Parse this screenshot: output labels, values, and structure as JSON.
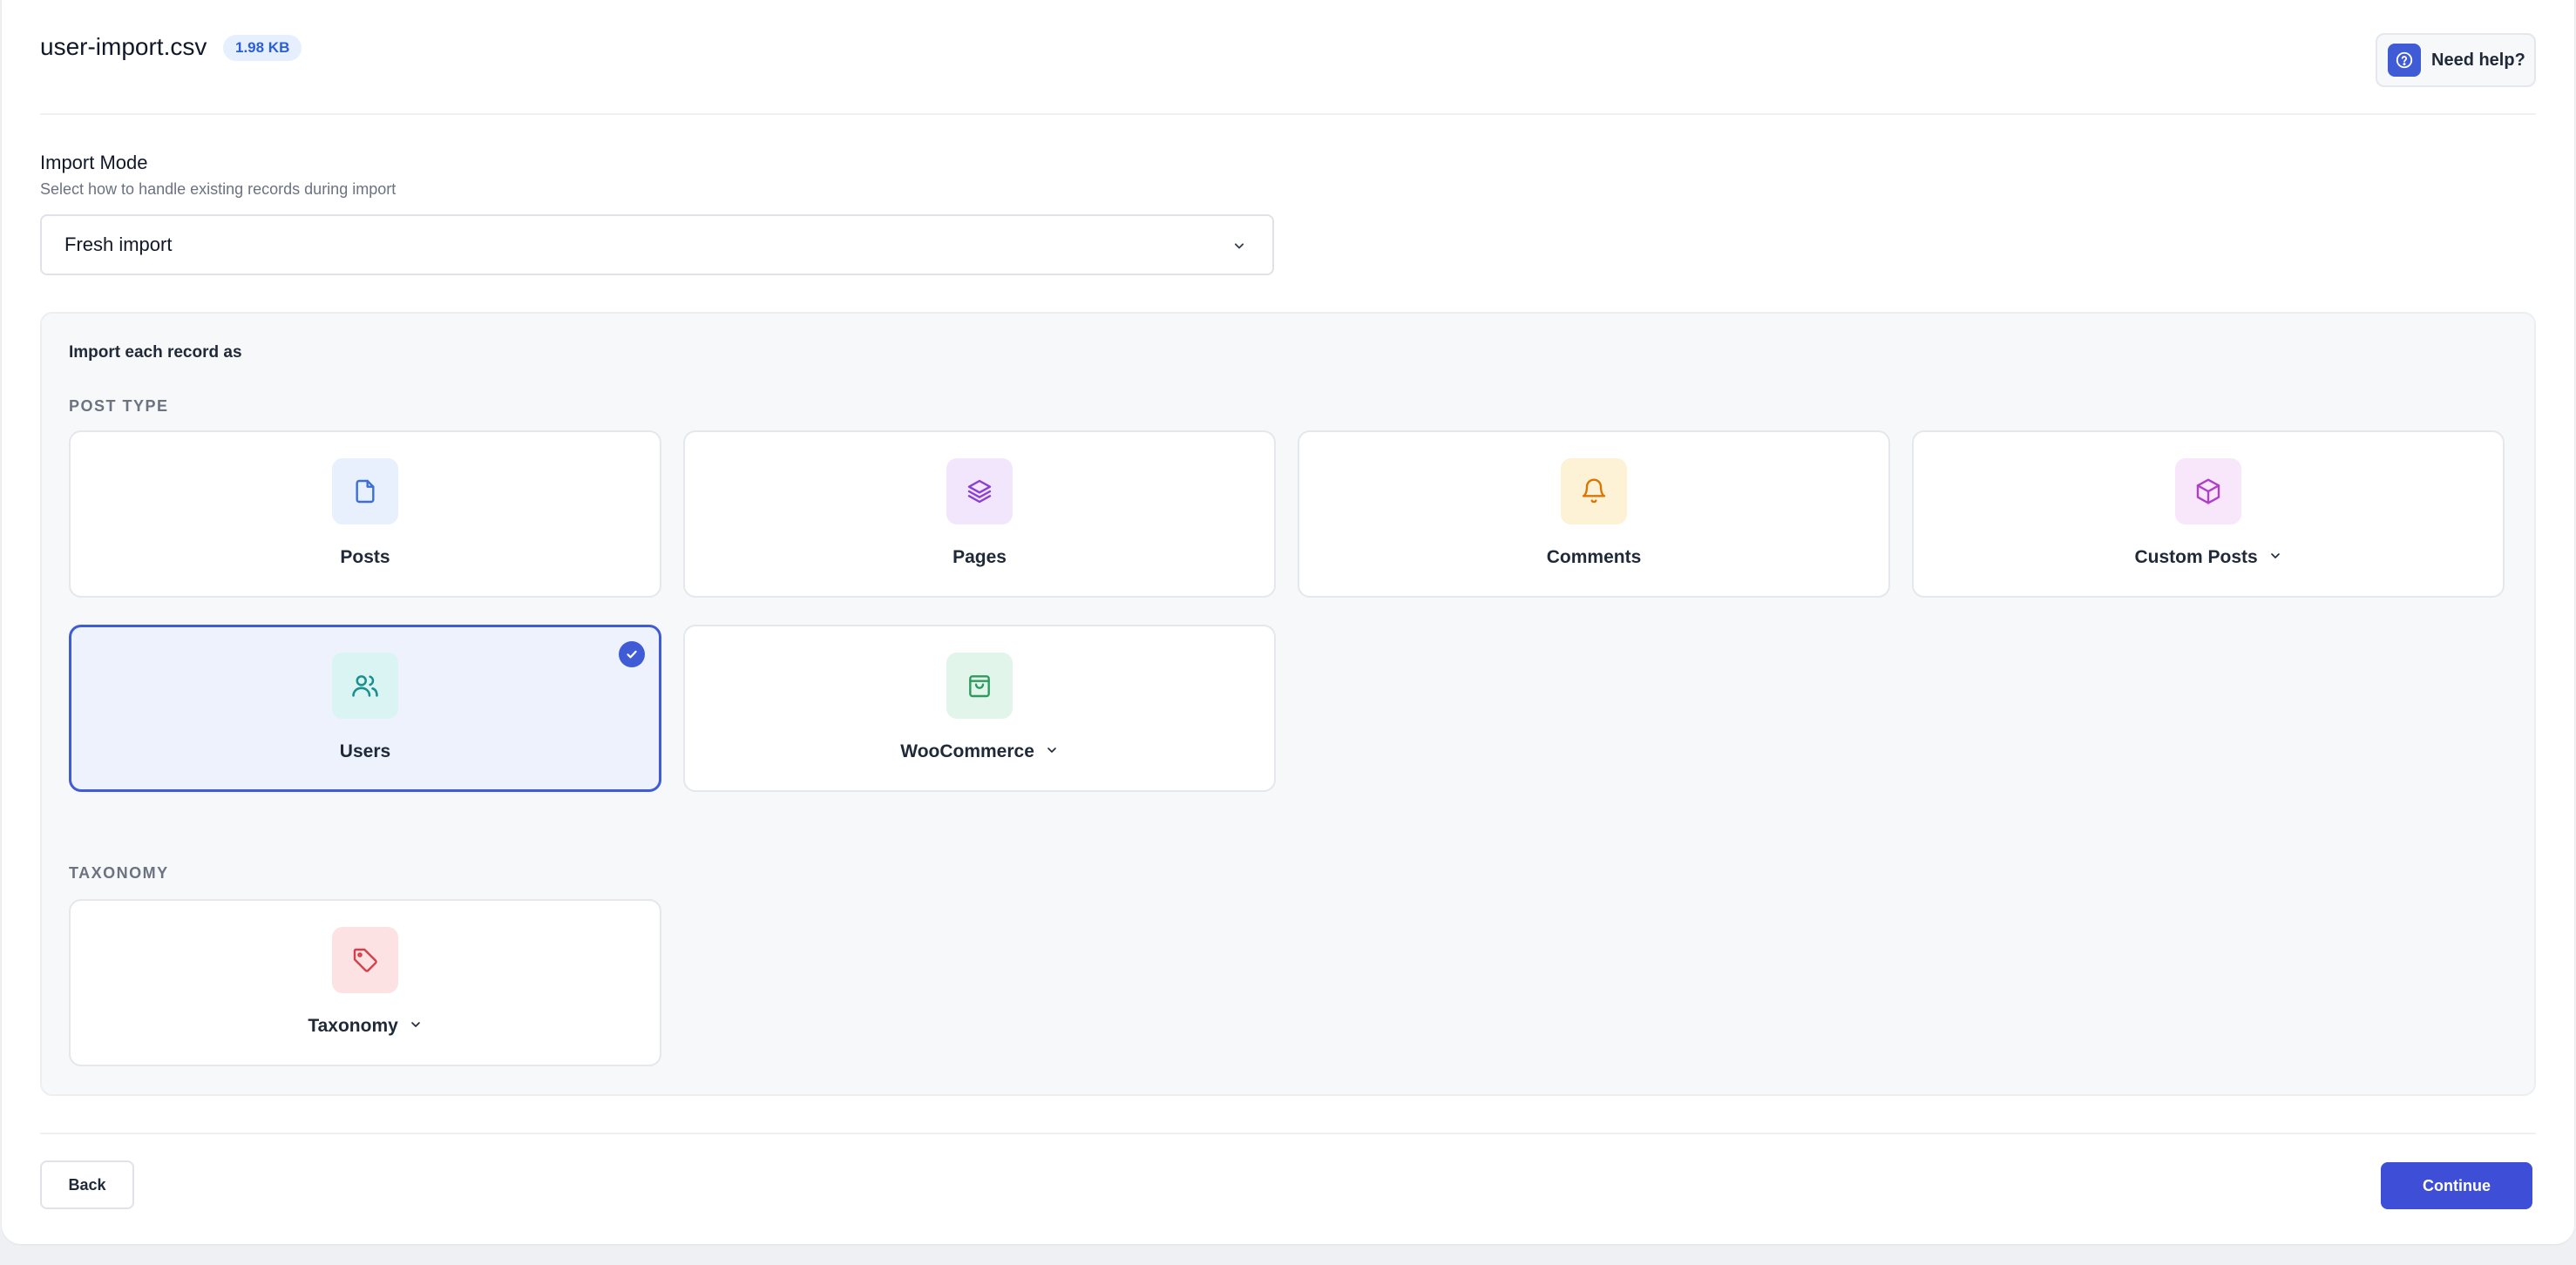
{
  "header": {
    "filename": "user-import.csv",
    "file_size": "1.98 KB",
    "help_label": "Need help?"
  },
  "import_mode": {
    "title": "Import Mode",
    "subtitle": "Select how to handle existing records during import",
    "selected": "Fresh import"
  },
  "record_section": {
    "title": "Import each record as",
    "post_type_label": "POST TYPE",
    "taxonomy_label": "TAXONOMY",
    "cards": [
      {
        "label": "Posts",
        "icon": "document-icon",
        "color": "#3b6fd8",
        "bg": "#e9f0fd",
        "dropdown": false,
        "selected": false
      },
      {
        "label": "Pages",
        "icon": "layers-icon",
        "color": "#8b3fd6",
        "bg": "#f2e6fd",
        "dropdown": false,
        "selected": false
      },
      {
        "label": "Comments",
        "icon": "bell-icon",
        "color": "#d97706",
        "bg": "#fdf1d6",
        "dropdown": false,
        "selected": false
      },
      {
        "label": "Custom Posts",
        "icon": "cube-icon",
        "color": "#b03fc9",
        "bg": "#f8e6fa",
        "dropdown": true,
        "selected": false
      },
      {
        "label": "Users",
        "icon": "users-icon",
        "color": "#1a8f8f",
        "bg": "#daf3f3",
        "dropdown": false,
        "selected": true
      },
      {
        "label": "WooCommerce",
        "icon": "shopping-bag-icon",
        "color": "#2f9a5e",
        "bg": "#e2f5ea",
        "dropdown": true,
        "selected": false
      },
      {
        "label": "Taxonomy",
        "icon": "tag-icon",
        "color": "#d63f4a",
        "bg": "#fde2e4",
        "dropdown": true,
        "selected": false
      }
    ]
  },
  "footer": {
    "back_label": "Back",
    "continue_label": "Continue"
  },
  "colors": {
    "accent": "#3f5bd6",
    "continue": "#3f4ed6"
  }
}
